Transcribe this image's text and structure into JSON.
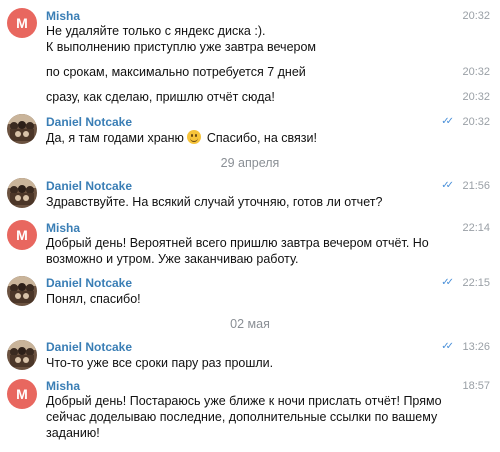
{
  "colors": {
    "sender_name": "#3a7eb5",
    "read_checks": "#4a90d9",
    "avatar_misha": "#e8675f",
    "time_text": "#9aa0a6"
  },
  "date_separators": [
    "29 апреля",
    "02 мая"
  ],
  "messages": [
    {
      "sender": "Misha",
      "avatar": "M",
      "lines": [
        "Не удаляйте только с яндекс диска :).",
        "К выполнению приступлю уже завтра вечером"
      ],
      "time": "20:32"
    },
    {
      "lines": [
        "по срокам, максимально потребуется 7 дней"
      ],
      "time": "20:32"
    },
    {
      "lines": [
        "сразу, как сделаю, пришлю отчёт сюда!"
      ],
      "time": "20:32",
      "read": true
    },
    {
      "sender": "Daniel Notcake",
      "avatar_icon": "user-photo",
      "lines_pre": "Да, я там годами храню",
      "lines_post": "Спасибо, на связи!",
      "emoji": "smiling-face",
      "time": "20:32",
      "read": true
    },
    {
      "sender": "Daniel Notcake",
      "avatar_icon": "user-photo",
      "lines": [
        "Здравствуйте. На всякий случай уточняю, готов ли отчет?"
      ],
      "time": "21:56",
      "read": true
    },
    {
      "sender": "Misha",
      "avatar": "M",
      "lines": [
        "Добрый день! Вероятней всего пришлю завтра вечером отчёт. Но",
        "возможно и утром. Уже заканчиваю работу."
      ],
      "time": "22:14"
    },
    {
      "sender": "Daniel Notcake",
      "avatar_icon": "user-photo",
      "lines": [
        "Понял, спасибо!"
      ],
      "time": "22:15",
      "read": true
    },
    {
      "sender": "Daniel Notcake",
      "avatar_icon": "user-photo",
      "lines": [
        "Что-то уже все сроки пару раз прошли."
      ],
      "time": "13:26",
      "read": true
    },
    {
      "sender": "Misha",
      "avatar": "M",
      "lines": [
        "Добрый день! Постараюсь уже ближе к ночи прислать отчёт! Прямо",
        "сейчас доделываю последние, дополнительные ссылки по вашему",
        "заданию!"
      ],
      "time": "18:57"
    }
  ]
}
